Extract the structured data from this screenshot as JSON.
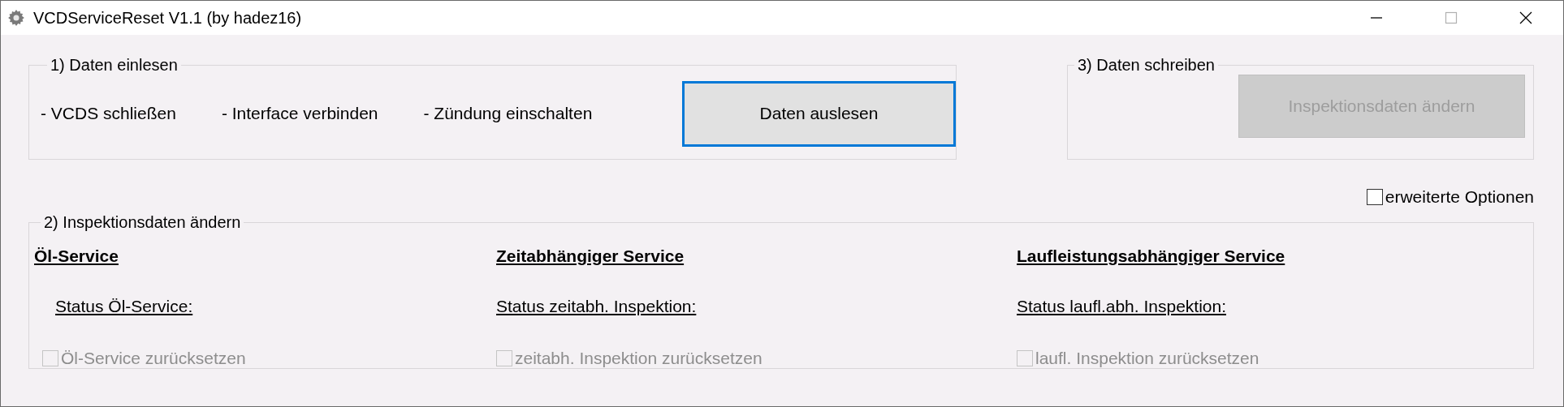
{
  "window": {
    "title": "VCDServiceReset V1.1 (by hadez16)"
  },
  "group_read": {
    "title": "1) Daten einlesen",
    "steps": [
      "- VCDS schließen",
      "- Interface verbinden",
      "- Zündung einschalten"
    ],
    "button": {
      "label": "Daten auslesen",
      "focused": true,
      "disabled": false
    }
  },
  "group_write": {
    "title": "3) Daten schreiben",
    "button": {
      "label": "Inspektionsdaten ändern",
      "focused": false,
      "disabled": true
    }
  },
  "extended_options": {
    "label": "erweiterte Optionen",
    "checked": false,
    "disabled": false
  },
  "group_inspection": {
    "title": "2) Inspektionsdaten ändern",
    "columns": [
      {
        "heading": "Öl-Service",
        "status": "Status Öl-Service:",
        "reset": {
          "label": "Öl-Service zurücksetzen",
          "checked": false,
          "disabled": true
        }
      },
      {
        "heading": "Zeitabhängiger Service",
        "status": "Status zeitabh. Inspektion:",
        "reset": {
          "label": "zeitabh. Inspektion zurücksetzen",
          "checked": false,
          "disabled": true
        }
      },
      {
        "heading": "Laufleistungsabhängiger Service",
        "status": "Status laufl.abh. Inspektion:",
        "reset": {
          "label": "laufl. Inspektion zurücksetzen",
          "checked": false,
          "disabled": true
        }
      }
    ]
  }
}
